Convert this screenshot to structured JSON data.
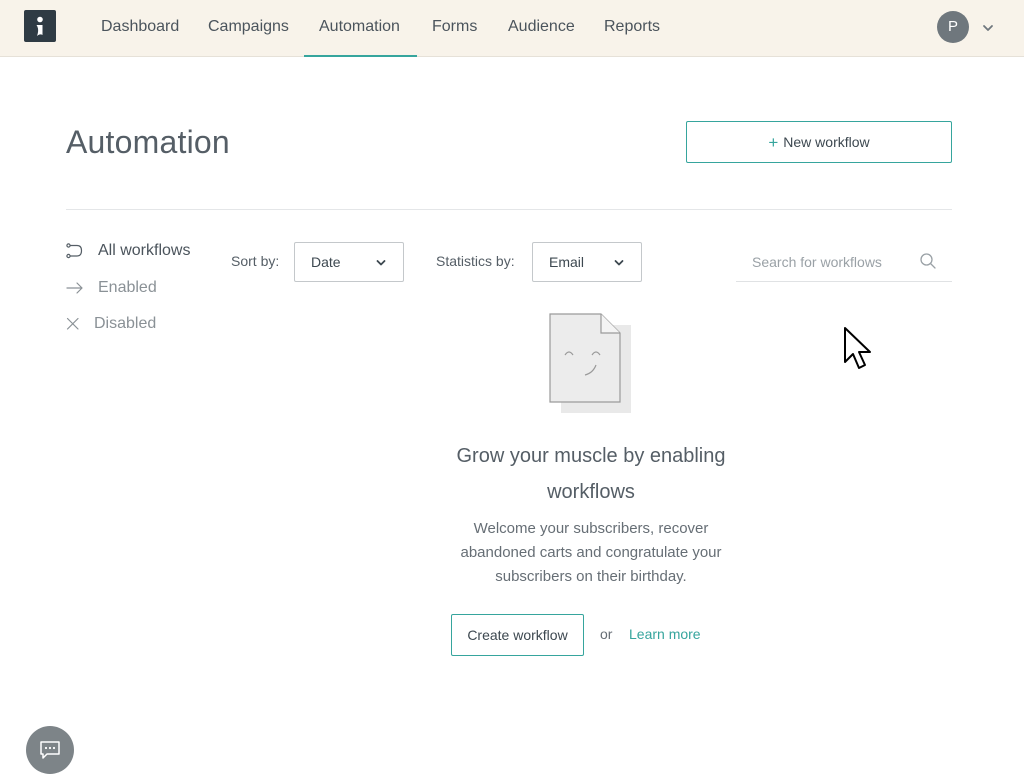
{
  "nav": {
    "items": [
      {
        "label": "Dashboard"
      },
      {
        "label": "Campaigns"
      },
      {
        "label": "Automation"
      },
      {
        "label": "Forms"
      },
      {
        "label": "Audience"
      },
      {
        "label": "Reports"
      }
    ],
    "active": "Automation",
    "avatar_initial": "P"
  },
  "header": {
    "title": "Automation",
    "new_workflow_label": "New workflow"
  },
  "sidebar": {
    "items": [
      {
        "label": "All workflows",
        "icon": "workflow-icon"
      },
      {
        "label": "Enabled",
        "icon": "arrow-right-icon"
      },
      {
        "label": "Disabled",
        "icon": "close-icon"
      }
    ]
  },
  "filters": {
    "sort_label": "Sort by:",
    "sort_value": "Date",
    "stats_label": "Statistics by:",
    "stats_value": "Email",
    "search_placeholder": "Search for workflows"
  },
  "empty_state": {
    "title": "Grow your muscle by enabling workflows",
    "description": "Welcome your subscribers, recover abandoned carts and congratulate your subscribers on their birthday.",
    "create_label": "Create workflow",
    "or_text": "or",
    "learn_more_label": "Learn more"
  },
  "colors": {
    "accent": "#36a59d",
    "topbar_bg": "#f8f3ea",
    "logo_bg": "#2f3b44"
  }
}
